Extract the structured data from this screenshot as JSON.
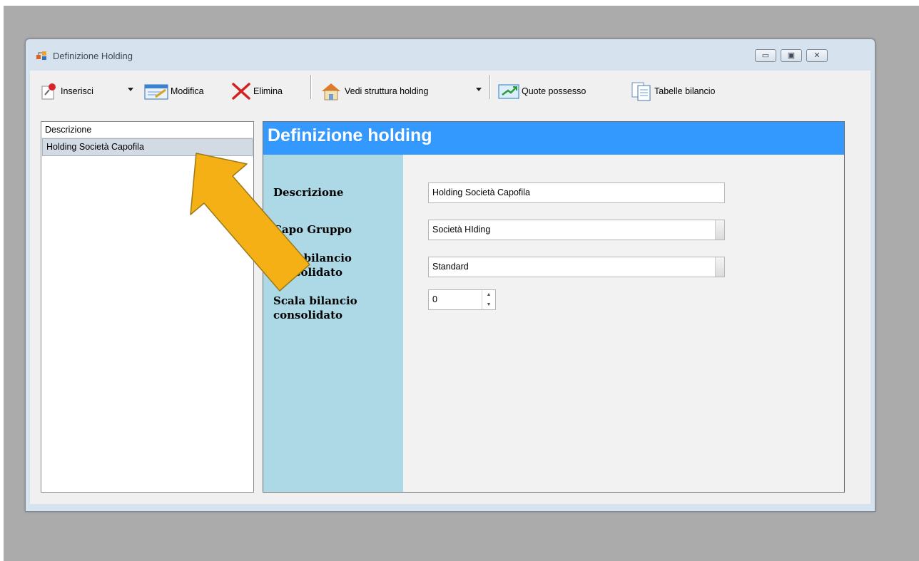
{
  "window": {
    "title": "Definizione Holding",
    "controls": [
      "minimize",
      "maximize",
      "close"
    ]
  },
  "toolbar": {
    "inserisci_label": "Inserisci",
    "modifica_label": "Modifica",
    "elimina_label": "Elimina",
    "vedi_label": "Vedi struttura holding",
    "quote_label": "Quote possesso",
    "tabelle_label": "Tabelle bilancio"
  },
  "list": {
    "header": "Descrizione",
    "rows": [
      "Holding Società Capofila"
    ]
  },
  "panel": {
    "title": "Definizione holding",
    "fields": {
      "descrizione_label": "Descrizione",
      "descrizione_value": "Holding Società Capofila",
      "capo_label": "Capo Gruppo",
      "capo_value": "Società HIding",
      "tipo_label": "Tipo bilancio consolidato",
      "tipo_value": "Standard",
      "scala_label": "Scala bilancio consolidato",
      "scala_value": "0"
    }
  },
  "colors": {
    "desktop": "#ababab",
    "panel_header": "#3399ff",
    "label_column": "#add8e6",
    "arrow_fill": "#f5b016",
    "arrow_stroke": "#9a7a18"
  },
  "icons": [
    "app-icon",
    "pushpin-icon",
    "edit-icon",
    "delete-x-icon",
    "house-icon",
    "chart-arrow-icon",
    "document-icon",
    "arrow-annotation"
  ]
}
